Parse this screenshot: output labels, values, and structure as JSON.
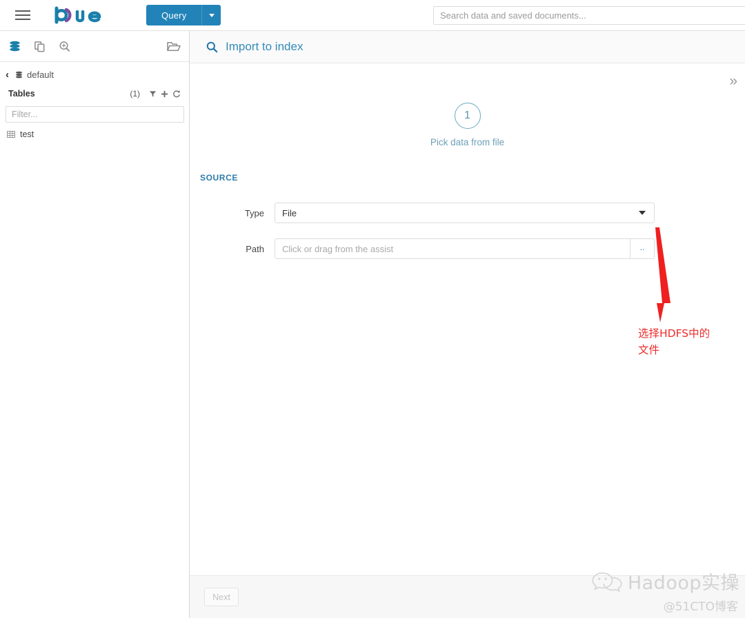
{
  "topnav": {
    "menu_icon": "hamburger-menu-icon",
    "logo_text": "hue",
    "query_button": {
      "label": "Query",
      "caret_icon": "chevron-down-icon"
    },
    "search": {
      "value": "",
      "placeholder": "Search data and saved documents..."
    }
  },
  "assist": {
    "tabs": [
      {
        "name": "sources-tab",
        "icon": "database-stack-icon",
        "active": true
      },
      {
        "name": "documents-tab",
        "icon": "documents-copy-icon",
        "active": false
      },
      {
        "name": "search-tab",
        "icon": "magnifier-plus-icon",
        "active": false
      }
    ],
    "folder_icon": "open-folder-icon",
    "breadcrumb": {
      "back_icon": "chevron-left-icon",
      "db_icon": "database-icon",
      "database": "default"
    },
    "tables_header": {
      "label": "Tables",
      "count": "(1)",
      "filter_icon": "funnel-filter-icon",
      "add_icon": "plus-icon",
      "refresh_icon": "refresh-icon"
    },
    "filter": {
      "value": "",
      "placeholder": "Filter..."
    },
    "tables": [
      {
        "icon": "table-grid-icon",
        "name": "test"
      }
    ]
  },
  "content": {
    "header": {
      "icon": "search-icon",
      "title": "Import to index"
    },
    "collapse_icon": "double-chevron-right-icon",
    "step": {
      "number": "1",
      "label": "Pick data from file"
    },
    "source_section_title": "SOURCE",
    "fields": {
      "type": {
        "label": "Type",
        "value": "File",
        "caret_icon": "caret-down-icon"
      },
      "path": {
        "label": "Path",
        "value": "",
        "placeholder": "Click or drag from the assist",
        "browse_label": ".."
      }
    },
    "footer": {
      "next_label": "Next",
      "next_disabled": true
    }
  },
  "annotation": {
    "arrow_icon": "red-down-arrow",
    "text_line1": "选择HDFS中的",
    "text_line2": "文件",
    "color": "#ee2b2b"
  },
  "watermark": {
    "icon": "wechat-icon",
    "name": "Hadoop实操",
    "source": "@51CTO博客"
  },
  "colors": {
    "brand_blue": "#2283b8",
    "header_title": "#338bb8",
    "source_label": "#2c7bad",
    "step_blue": "#6d9fb6",
    "annotation_red": "#ee2b2b"
  }
}
